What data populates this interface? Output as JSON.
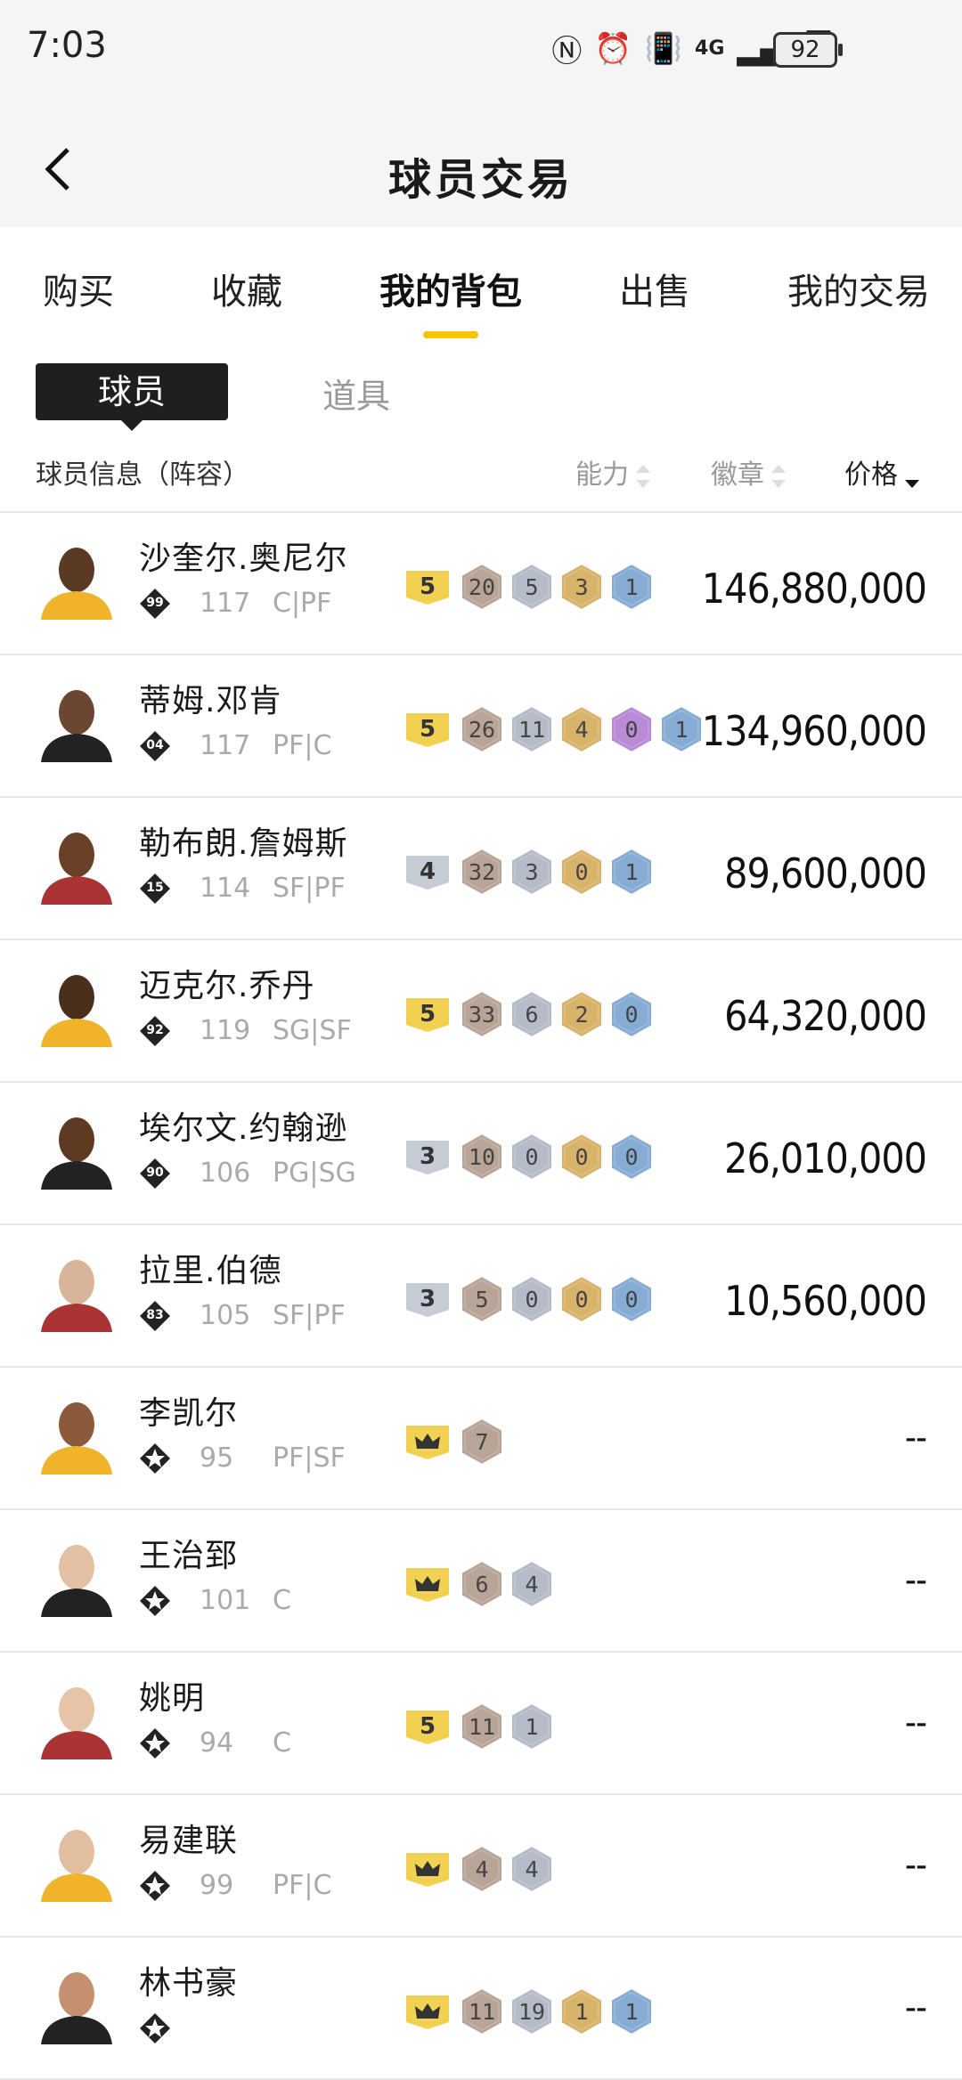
{
  "status_bar": {
    "time": "7:03",
    "network": "4G",
    "battery": "92"
  },
  "header": {
    "title": "球员交易"
  },
  "tabs": [
    {
      "label": "购买",
      "active": false
    },
    {
      "label": "收藏",
      "active": false
    },
    {
      "label": "我的背包",
      "active": true
    },
    {
      "label": "出售",
      "active": false
    },
    {
      "label": "我的交易",
      "active": false
    }
  ],
  "subtabs": {
    "active": "球员",
    "other": "道具"
  },
  "columns": {
    "info": "球员信息（阵容）",
    "ability": "能力",
    "badge": "徽章",
    "price": "价格"
  },
  "players": [
    {
      "name": "沙奎尔.奥尼尔",
      "rating_badge": "99",
      "ovr": "117",
      "position": "C|PF",
      "tier": "5",
      "tier_type": "gold",
      "badges": [
        "20",
        "5",
        "3",
        "1"
      ],
      "price": "146,880,000"
    },
    {
      "name": "蒂姆.邓肯",
      "rating_badge": "04",
      "ovr": "117",
      "position": "PF|C",
      "tier": "5",
      "tier_type": "gold",
      "badges": [
        "26",
        "11",
        "4",
        "0",
        "1"
      ],
      "price": "134,960,000"
    },
    {
      "name": "勒布朗.詹姆斯",
      "rating_badge": "15",
      "ovr": "114",
      "position": "SF|PF",
      "tier": "4",
      "tier_type": "silver",
      "badges": [
        "32",
        "3",
        "0",
        "1"
      ],
      "price": "89,600,000"
    },
    {
      "name": "迈克尔.乔丹",
      "rating_badge": "92",
      "ovr": "119",
      "position": "SG|SF",
      "tier": "5",
      "tier_type": "gold",
      "badges": [
        "33",
        "6",
        "2",
        "0"
      ],
      "price": "64,320,000"
    },
    {
      "name": "埃尔文.约翰逊",
      "rating_badge": "90",
      "ovr": "106",
      "position": "PG|SG",
      "tier": "3",
      "tier_type": "silver",
      "badges": [
        "10",
        "0",
        "0",
        "0"
      ],
      "price": "26,010,000"
    },
    {
      "name": "拉里.伯德",
      "rating_badge": "83",
      "ovr": "105",
      "position": "SF|PF",
      "tier": "3",
      "tier_type": "silver",
      "badges": [
        "5",
        "0",
        "0",
        "0"
      ],
      "price": "10,560,000"
    },
    {
      "name": "李凯尔",
      "rating_badge": "",
      "ovr": "95",
      "position": "PF|SF",
      "tier": "",
      "tier_type": "crown",
      "badges": [
        "7"
      ],
      "price": "--"
    },
    {
      "name": "王治郅",
      "rating_badge": "",
      "ovr": "101",
      "position": "C",
      "tier": "",
      "tier_type": "crown",
      "badges": [
        "6",
        "4"
      ],
      "price": "--"
    },
    {
      "name": "姚明",
      "rating_badge": "",
      "ovr": "94",
      "position": "C",
      "tier": "5",
      "tier_type": "gold",
      "badges": [
        "11",
        "1"
      ],
      "price": "--"
    },
    {
      "name": "易建联",
      "rating_badge": "",
      "ovr": "99",
      "position": "PF|C",
      "tier": "",
      "tier_type": "crown",
      "badges": [
        "4",
        "4"
      ],
      "price": "--"
    },
    {
      "name": "林书豪",
      "rating_badge": "",
      "ovr": "",
      "position": "",
      "tier": "",
      "tier_type": "crown",
      "badges": [
        "11",
        "19",
        "1",
        "1"
      ],
      "price": "--"
    }
  ],
  "colors": {
    "accent": "#f5c400",
    "hex_bronze": "#b9a597",
    "hex_silver": "#b5bcc8",
    "hex_gold": "#d8b36a",
    "hex_purple": "#b98ad6",
    "hex_blue": "#86acd4"
  }
}
